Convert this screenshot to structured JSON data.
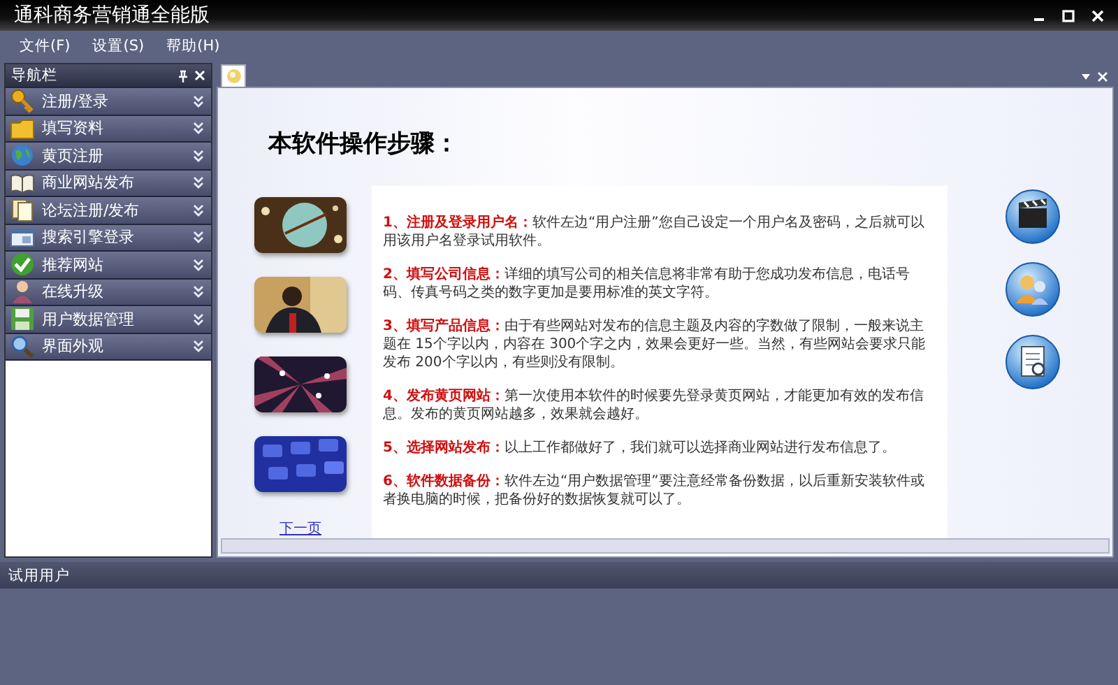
{
  "window": {
    "title": "通科商务营销通全能版"
  },
  "menu": [
    "文件(F)",
    "设置(S)",
    "帮助(H)"
  ],
  "nav_panel": {
    "title": "导航栏",
    "items": [
      {
        "label": "注册/登录"
      },
      {
        "label": "填写资料"
      },
      {
        "label": "黄页注册"
      },
      {
        "label": "商业网站发布"
      },
      {
        "label": "论坛注册/发布"
      },
      {
        "label": "搜索引擎登录"
      },
      {
        "label": "推荐网站"
      },
      {
        "label": "在线升级"
      },
      {
        "label": "用户数据管理"
      },
      {
        "label": "界面外观"
      }
    ]
  },
  "page": {
    "title": "本软件操作步骤：",
    "next_link": "下一页",
    "steps": [
      "**1、注册及登录用户名：**软件左边“用户注册”您自己设定一个用户名及密码，之后就可以用该用户名登录试用软件。",
      "**2、填写公司信息：**详细的填写公司的相关信息将非常有助于您成功发布信息，电话号码、传真号码之类的数字更加是要用标准的英文字符。",
      "**3、填写产品信息：**由于有些网站对发布的信息主题及内容的字数做了限制，一般来说主题在 15个字以内，内容在 300个字之内，效果会更好一些。当然，有些网站会要求只能发布 200个字以内，有些则没有限制。",
      "**4、发布黄页网站：**第一次使用本软件的时候要先登录黄页网站，才能更加有效的发布信息。发布的黄页网站越多，效果就会越好。",
      "**5、选择网站发布：**以上工作都做好了，我们就可以选择商业网站进行发布信息了。",
      "**6、软件数据备份：**软件左边“用户数据管理”要注意经常备份数据，以后重新安装软件或者换电脑的时候，把备份好的数据恢复就可以了。"
    ]
  },
  "status_bar": "试用用户"
}
